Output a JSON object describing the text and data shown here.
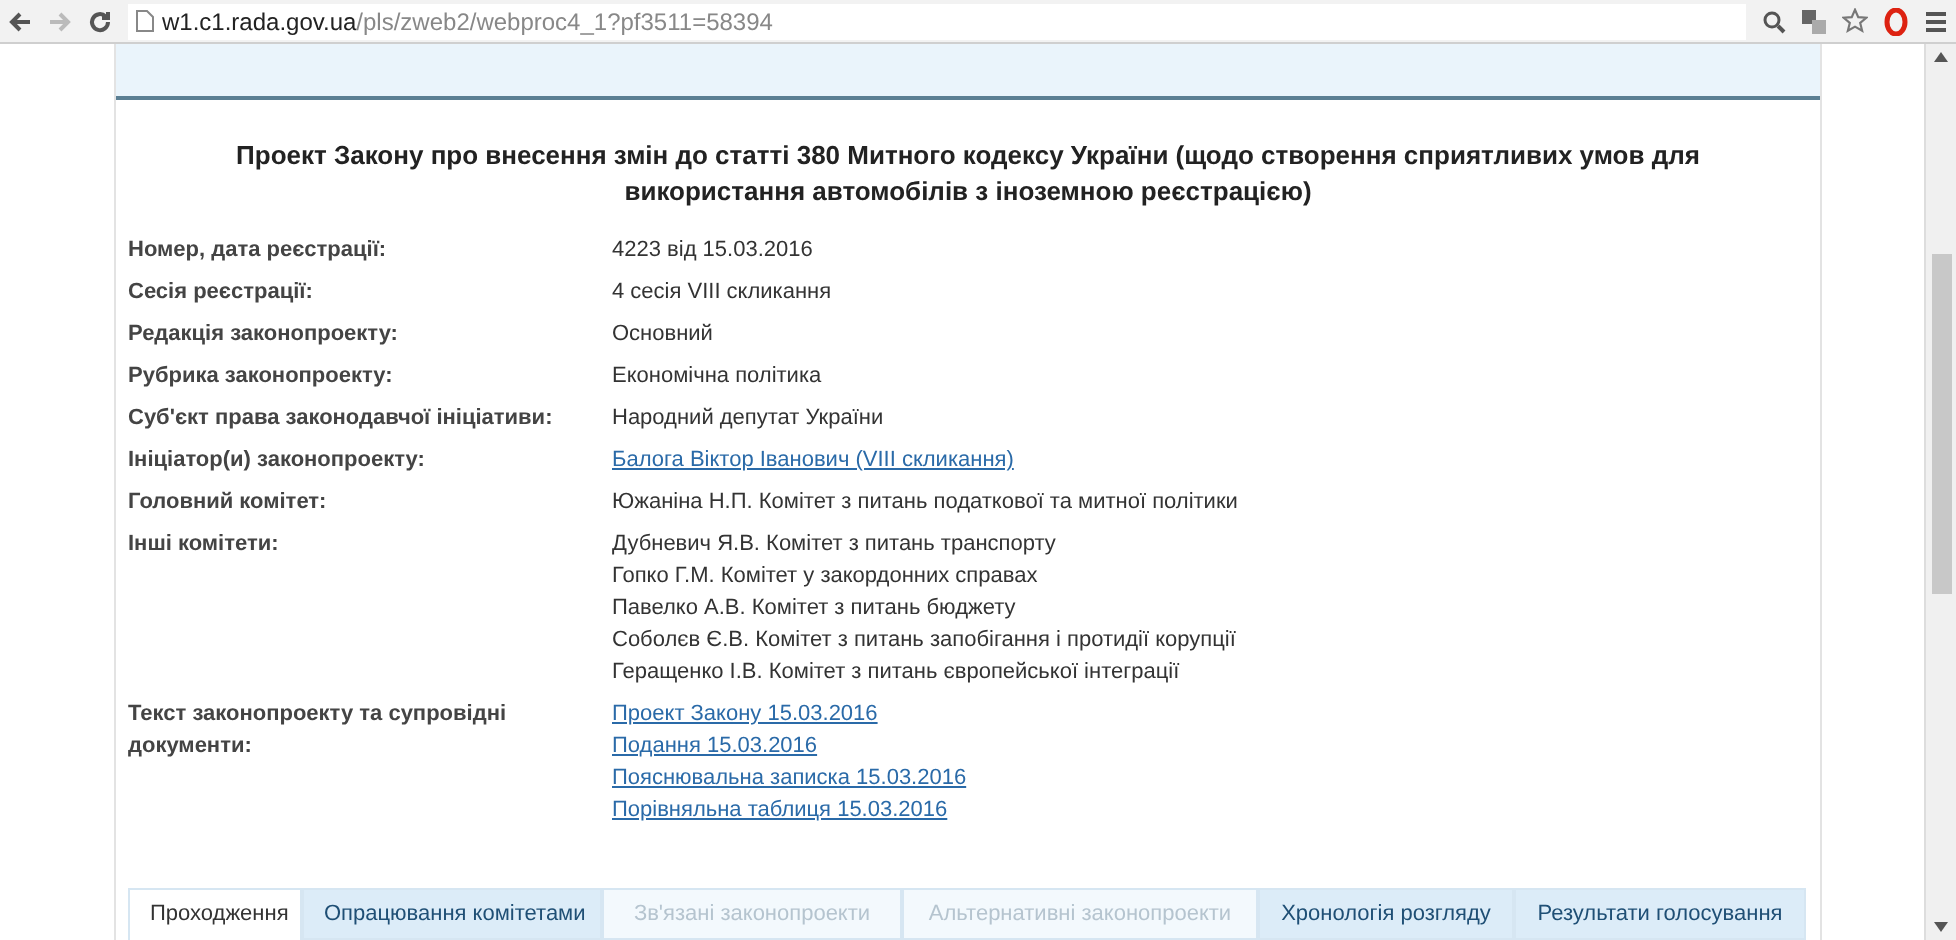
{
  "browser": {
    "url_host": "w1.c1.rada.gov.ua",
    "url_path": "/pls/zweb2/webproc4_1?pf3511=58394"
  },
  "title": "Проект Закону про внесення змін до статті 380 Митного кодексу України (щодо створення сприятливих умов для використання автомобілів з іноземною реєстрацією)",
  "fields": [
    {
      "label": "Номер, дата реєстрації:",
      "values": [
        {
          "text": "4223 від 15.03.2016",
          "link": false
        }
      ]
    },
    {
      "label": "Сесія реєстрації:",
      "values": [
        {
          "text": "4 сесія VIII скликання",
          "link": false
        }
      ]
    },
    {
      "label": "Редакція законопроекту:",
      "values": [
        {
          "text": "Основний",
          "link": false
        }
      ]
    },
    {
      "label": "Рубрика законопроекту:",
      "values": [
        {
          "text": "Економічна політика",
          "link": false
        }
      ]
    },
    {
      "label": "Суб'єкт права законодавчої ініціативи:",
      "values": [
        {
          "text": "Народний депутат України",
          "link": false
        }
      ]
    },
    {
      "label": "Ініціатор(и) законопроекту:",
      "values": [
        {
          "text": "Балога Віктор Іванович (VIII скликання)",
          "link": true
        }
      ]
    },
    {
      "label": "Головний комітет:",
      "values": [
        {
          "text": "Южаніна Н.П. Комітет з питань податкової та митної політики",
          "link": false
        }
      ]
    },
    {
      "label": "Інші комітети:",
      "values": [
        {
          "text": "Дубневич Я.В. Комітет з питань транспорту",
          "link": false
        },
        {
          "text": "Гопко Г.М. Комітет у закордонних справах",
          "link": false
        },
        {
          "text": "Павелко А.В. Комітет з питань бюджету",
          "link": false
        },
        {
          "text": "Соболєв Є.В. Комітет з питань запобігання і протидії корупції",
          "link": false
        },
        {
          "text": "Геращенко І.В. Комітет з питань європейської інтеграції",
          "link": false
        }
      ]
    },
    {
      "label": "Текст законопроекту та супровідні документи:",
      "values": [
        {
          "text": "Проект Закону 15.03.2016",
          "link": true
        },
        {
          "text": "Подання 15.03.2016",
          "link": true
        },
        {
          "text": "Пояснювальна записка 15.03.2016",
          "link": true
        },
        {
          "text": "Порівняльна таблиця 15.03.2016",
          "link": true
        }
      ]
    }
  ],
  "tabs": [
    {
      "label": "Проходження",
      "selected": true,
      "disabled": false
    },
    {
      "label": "Опрацювання комітетами",
      "selected": false,
      "disabled": false
    },
    {
      "label": "Зв'язані законопроекти",
      "selected": false,
      "disabled": true
    },
    {
      "label": "Альтернативні законопроекти",
      "selected": false,
      "disabled": true
    },
    {
      "label": "Хронологія розгляду",
      "selected": false,
      "disabled": false
    },
    {
      "label": "Результати голосування",
      "selected": false,
      "disabled": false
    }
  ]
}
